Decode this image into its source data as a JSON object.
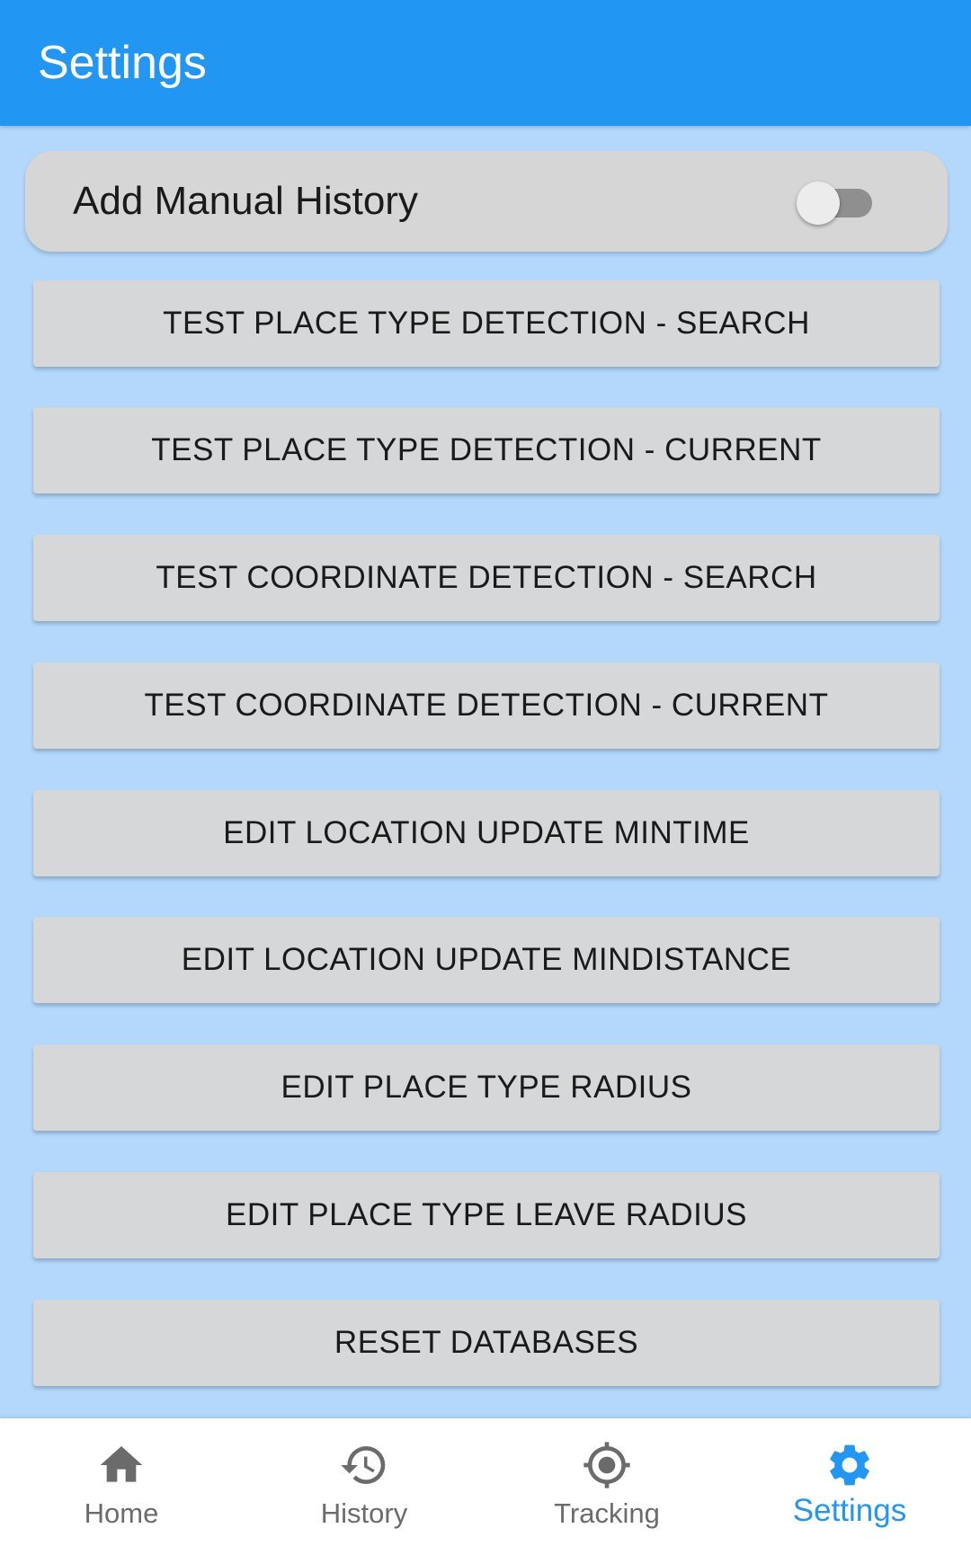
{
  "app_bar": {
    "title": "Settings"
  },
  "manual_history": {
    "label": "Add Manual History",
    "enabled": false
  },
  "buttons": [
    {
      "label": "TEST PLACE TYPE DETECTION - SEARCH"
    },
    {
      "label": "TEST PLACE TYPE DETECTION - CURRENT"
    },
    {
      "label": "TEST COORDINATE DETECTION - SEARCH"
    },
    {
      "label": "TEST COORDINATE DETECTION - CURRENT"
    },
    {
      "label": "EDIT LOCATION UPDATE MINTIME"
    },
    {
      "label": "EDIT LOCATION UPDATE MINDISTANCE"
    },
    {
      "label": "EDIT PLACE TYPE RADIUS"
    },
    {
      "label": "EDIT PLACE TYPE LEAVE RADIUS"
    },
    {
      "label": "RESET DATABASES"
    }
  ],
  "bottom_nav": {
    "items": [
      {
        "label": "Home",
        "icon": "home-icon",
        "active": false
      },
      {
        "label": "History",
        "icon": "history-icon",
        "active": false
      },
      {
        "label": "Tracking",
        "icon": "gps-fixed-icon",
        "active": false
      },
      {
        "label": "Settings",
        "icon": "gear-icon",
        "active": true
      }
    ]
  },
  "colors": {
    "primary": "#2196f3",
    "background": "#b3d8fc",
    "button": "#d6d7d8",
    "inactive_nav": "#6b6b6b"
  }
}
